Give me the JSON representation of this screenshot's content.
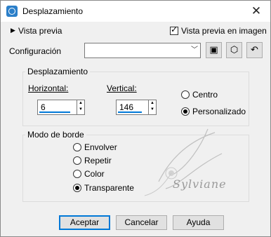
{
  "window": {
    "title": "Desplazamiento"
  },
  "preview": {
    "toggle_label": "Vista previa",
    "checkbox_label": "Vista previa en imagen",
    "checked": true
  },
  "config": {
    "label": "Configuración",
    "value": ""
  },
  "offset": {
    "group_label": "Desplazamiento",
    "horizontal_label": "Horizontal:",
    "horizontal_value": "6",
    "vertical_label": "Vertical:",
    "vertical_value": "146",
    "options": [
      {
        "label": "Centro",
        "selected": false
      },
      {
        "label": "Personalizado",
        "selected": true
      }
    ]
  },
  "border": {
    "group_label": "Modo de borde",
    "options": [
      {
        "label": "Envolver",
        "selected": false
      },
      {
        "label": "Repetir",
        "selected": false
      },
      {
        "label": "Color",
        "selected": false
      },
      {
        "label": "Transparente",
        "selected": true
      }
    ]
  },
  "watermark": {
    "text": "Sylviane"
  },
  "buttons": {
    "ok": "Aceptar",
    "cancel": "Cancelar",
    "help": "Ayuda"
  },
  "icons": [
    "app-icon",
    "close-icon",
    "triangle-right-icon",
    "save-preset-icon",
    "random-icon",
    "reset-icon"
  ]
}
